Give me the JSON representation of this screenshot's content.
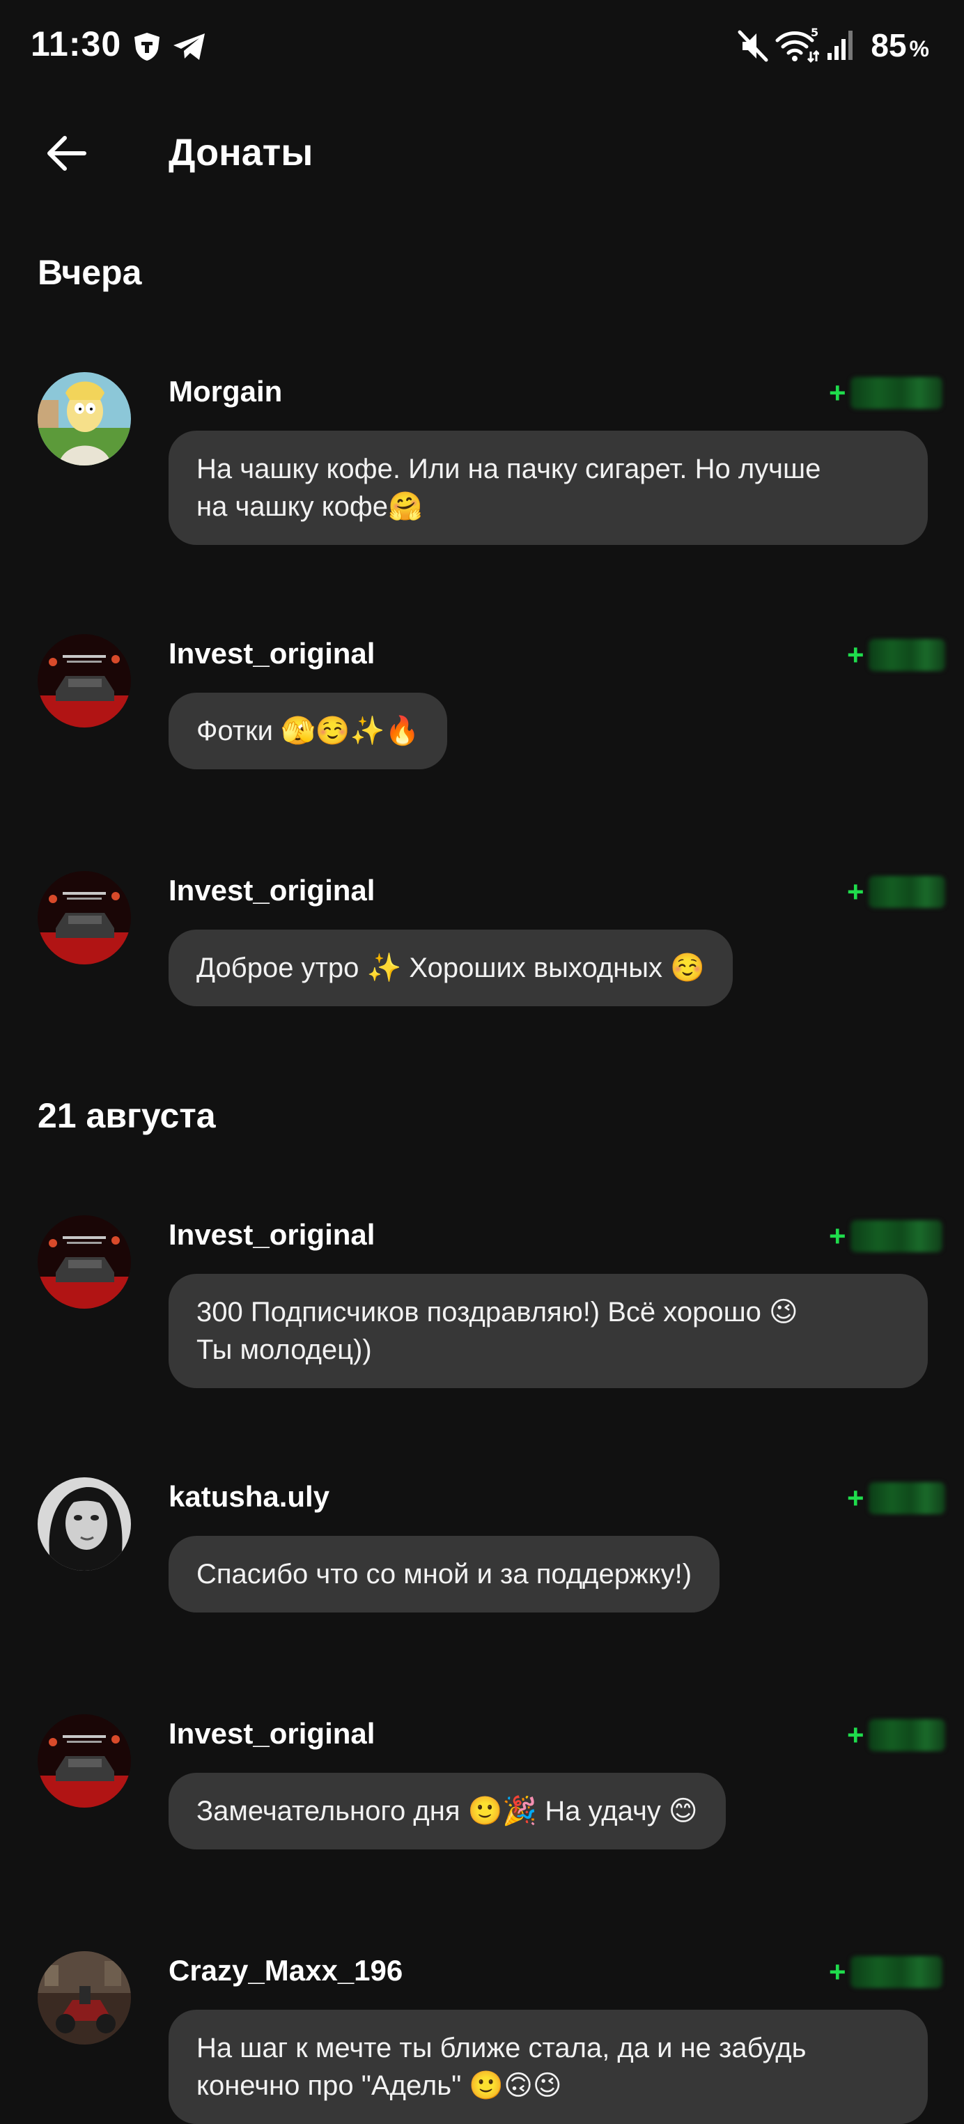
{
  "status_bar": {
    "time": "11:30",
    "battery_value": "85",
    "battery_unit": "%",
    "icons": [
      "shield-app-icon",
      "telegram-icon",
      "mute-icon",
      "wifi-icon",
      "signal-icon"
    ]
  },
  "appbar": {
    "title": "Донаты",
    "back_icon": "arrow-left-icon"
  },
  "colors": {
    "background": "#111111",
    "bubble": "#373737",
    "amount_accent": "#1fdc4c"
  },
  "sections": [
    {
      "header": "Вчера",
      "donations": [
        {
          "user": "Morgain",
          "amount_prefix": "+",
          "message": "На чашку кофе. Или на пачку сигарет. Но лучше\nна чашку кофе🤗"
        },
        {
          "user": "Invest_original",
          "amount_prefix": "+",
          "message": "Фотки 🫣☺️✨🔥"
        },
        {
          "user": "Invest_original",
          "amount_prefix": "+",
          "message": "Доброе утро ✨ Хороших выходных ☺️"
        }
      ]
    },
    {
      "header": "21 августа",
      "donations": [
        {
          "user": "Invest_original",
          "amount_prefix": "+",
          "message": "300 Подписчиков поздравляю!) Всё хорошо 😉\nТы молодец))"
        },
        {
          "user": "katusha.uly",
          "amount_prefix": "+",
          "message": "Спасибо что со мной и за поддержку!)"
        },
        {
          "user": "Invest_original",
          "amount_prefix": "+",
          "message": "Замечательного дня 🙂🎉 На удачу 😊"
        },
        {
          "user": "Crazy_Maxx_196",
          "amount_prefix": "+",
          "message": "На шаг к мечте ты ближе стала, да и не забудь\nконечно про \"Адель\" 🙂🙃😉"
        }
      ]
    }
  ]
}
